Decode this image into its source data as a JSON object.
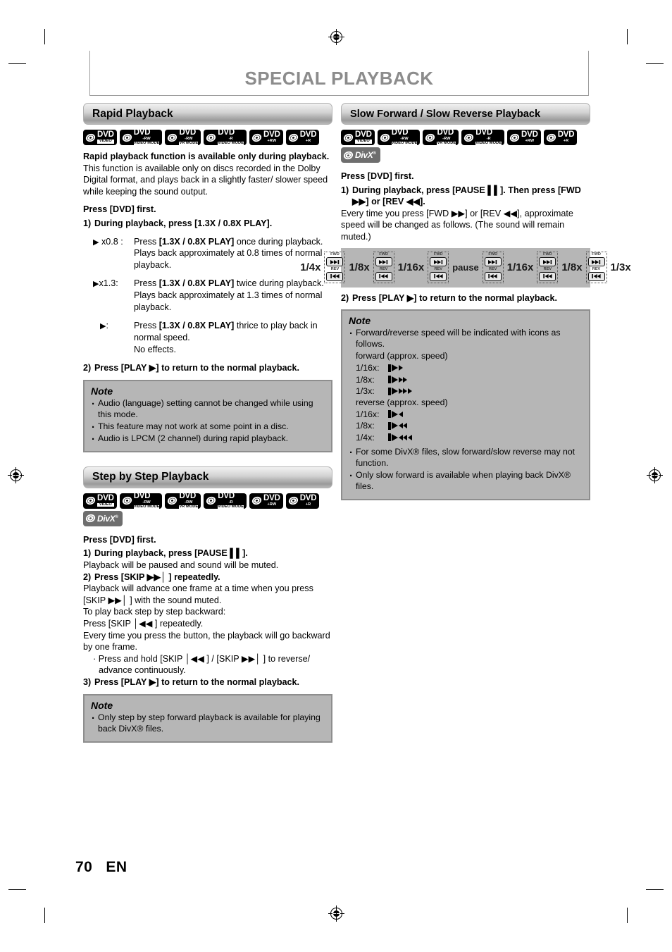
{
  "page": {
    "title": "SPECIAL PLAYBACK",
    "number": "70",
    "language": "EN"
  },
  "left_column": {
    "sections": [
      {
        "heading": "Rapid Playback",
        "discs": [
          {
            "main": "DVD",
            "sub1": "",
            "sub2": "VIDEO",
            "type": "dvd"
          },
          {
            "main": "DVD",
            "sub1": "-RW",
            "sub2": "VIDEO MODE",
            "type": "dvd"
          },
          {
            "main": "DVD",
            "sub1": "-RW",
            "sub2": "VR MODE",
            "type": "dvd"
          },
          {
            "main": "DVD",
            "sub1": "-R",
            "sub2": "VIDEO MODE",
            "type": "dvd"
          },
          {
            "main": "DVD",
            "sub1": "+RW",
            "sub2": "",
            "type": "dvd"
          },
          {
            "main": "DVD",
            "sub1": "+R",
            "sub2": "",
            "type": "dvd"
          }
        ],
        "lead_bold": "Rapid playback function is available only during playback.",
        "lead_body": "This function is available only on discs recorded in the Dolby Digital format, and plays back in a slightly faster/ slower speed while keeping the sound output.",
        "press_first": "Press [DVD] first.",
        "step1_num": "1)",
        "step1_text": "During playback, press [1.3X / 0.8X PLAY].",
        "speed_items": [
          {
            "label": "x0.8 :",
            "line1_pre": "Press ",
            "line1_bold": "[1.3X / 0.8X PLAY]",
            "line1_post": " once during playback.",
            "line2": "Plays back approximately at 0.8 times of normal playback."
          },
          {
            "label": "x1.3:",
            "line1_pre": "Press ",
            "line1_bold": "[1.3X / 0.8X PLAY]",
            "line1_post": " twice during playback.",
            "line2": "Plays back approximately at 1.3 times of normal playback."
          },
          {
            "label": ":",
            "line1_pre": "Press ",
            "line1_bold": "[1.3X / 0.8X PLAY]",
            "line1_post": " thrice to play back in normal speed.",
            "line2": "No effects."
          }
        ],
        "step2_num": "2)",
        "step2_text": "Press [PLAY ▶] to return to the normal playback.",
        "note": {
          "title": "Note",
          "items": [
            "Audio (language) setting cannot be changed while using this mode.",
            "This feature may not work at some point in a disc.",
            "Audio is LPCM (2 channel) during rapid playback."
          ]
        }
      },
      {
        "heading": "Step by Step Playback",
        "discs": [
          {
            "main": "DVD",
            "sub1": "",
            "sub2": "VIDEO",
            "type": "dvd"
          },
          {
            "main": "DVD",
            "sub1": "-RW",
            "sub2": "VIDEO MODE",
            "type": "dvd"
          },
          {
            "main": "DVD",
            "sub1": "-RW",
            "sub2": "VR MODE",
            "type": "dvd"
          },
          {
            "main": "DVD",
            "sub1": "-R",
            "sub2": "VIDEO MODE",
            "type": "dvd"
          },
          {
            "main": "DVD",
            "sub1": "+RW",
            "sub2": "",
            "type": "dvd"
          },
          {
            "main": "DVD",
            "sub1": "+R",
            "sub2": "",
            "type": "dvd"
          }
        ],
        "divx_label": "DivX",
        "press_first": "Press [DVD] first.",
        "steps": [
          {
            "num": "1)",
            "text": "During playback, press [PAUSE ▌▌].",
            "sub": [
              "Playback will be paused and sound will be muted."
            ]
          },
          {
            "num": "2)",
            "text": "Press [SKIP ▶▶│ ] repeatedly.",
            "sub": [
              "Playback will advance one frame at a time when you press [SKIP ▶▶│ ] with the sound muted.",
              "To play back step by step backward:",
              "Press [SKIP │◀◀ ] repeatedly.",
              "Every time you press the button, the playback will go backward by one frame."
            ],
            "bullet": "Press and hold [SKIP │◀◀ ] / [SKIP ▶▶│ ] to reverse/ advance continuously."
          },
          {
            "num": "3)",
            "text": "Press [PLAY ▶] to return to the normal playback.",
            "sub": []
          }
        ],
        "note": {
          "title": "Note",
          "items": [
            "Only step by step forward playback is available for playing back DivX® files."
          ]
        }
      }
    ]
  },
  "right_column": {
    "sections": [
      {
        "heading": "Slow Forward / Slow Reverse Playback",
        "discs": [
          {
            "main": "DVD",
            "sub1": "",
            "sub2": "VIDEO",
            "type": "dvd"
          },
          {
            "main": "DVD",
            "sub1": "-RW",
            "sub2": "VIDEO MODE",
            "type": "dvd"
          },
          {
            "main": "DVD",
            "sub1": "-RW",
            "sub2": "VR MODE",
            "type": "dvd"
          },
          {
            "main": "DVD",
            "sub1": "-R",
            "sub2": "VIDEO MODE",
            "type": "dvd"
          },
          {
            "main": "DVD",
            "sub1": "+RW",
            "sub2": "",
            "type": "dvd"
          },
          {
            "main": "DVD",
            "sub1": "+R",
            "sub2": "",
            "type": "dvd"
          }
        ],
        "divx_label": "DivX",
        "press_first": "Press [DVD] first.",
        "step1_num": "1)",
        "step1_text": "During playback, press [PAUSE ▌▌]. Then press [FWD ▶▶] or [REV ◀◀].",
        "step1_sub": "Every time you press [FWD ▶▶] or [REV ◀◀], approximate speed will be changed as follows. (The sound will remain muted.)",
        "diagram": {
          "steps": [
            {
              "label": "1/4x",
              "button": true
            },
            {
              "label": "1/8x",
              "button": true
            },
            {
              "label": "1/16x",
              "button": true
            },
            {
              "label": "pause",
              "button": false
            },
            {
              "label": "1/16x",
              "button": true
            },
            {
              "label": "1/8x",
              "button": true
            },
            {
              "label": "1/3x",
              "button": false
            }
          ],
          "fwd_caption": "FWD",
          "rev_caption": "REV"
        },
        "step2_num": "2)",
        "step2_text": "Press [PLAY ▶] to return to the normal playback.",
        "note": {
          "title": "Note",
          "bullet1": "Forward/reverse speed will be indicated with icons as follows.",
          "forward_label": "forward (approx. speed)",
          "forward_speeds": [
            {
              "key": "1/16x:",
              "arrows": 1
            },
            {
              "key": "1/8x:",
              "arrows": 2
            },
            {
              "key": "1/3x:",
              "arrows": 3
            }
          ],
          "reverse_label": "reverse (approx. speed)",
          "reverse_speeds": [
            {
              "key": "1/16x:",
              "arrows": 1
            },
            {
              "key": "1/8x:",
              "arrows": 2
            },
            {
              "key": "1/4x:",
              "arrows": 3
            }
          ],
          "bullet2": "For some DivX® files, slow forward/slow reverse may not function.",
          "bullet3": "Only slow forward is available when playing back DivX® files."
        }
      }
    ]
  },
  "colors": {
    "note_bg": "#b6b6b6",
    "note_border": "#8e8e8e",
    "title_gray": "#8c8c8c",
    "badge_black": "#000000",
    "badge_divx": "#6e6e6e"
  }
}
